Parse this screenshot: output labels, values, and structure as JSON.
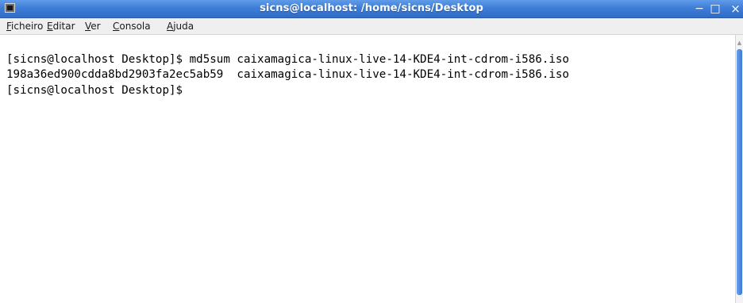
{
  "window": {
    "title": "sicns@localhost: /home/sicns/Desktop",
    "minimize_glyph": "−",
    "maximize_glyph": "□",
    "close_glyph": "×",
    "titlebar_color": "#3f7ed8"
  },
  "menubar": {
    "items": [
      {
        "accel": "F",
        "rest": "icheiro"
      },
      {
        "accel": "E",
        "rest": "ditar"
      },
      {
        "accel": "V",
        "rest": "er"
      },
      {
        "accel": "C",
        "rest": "onsola"
      },
      {
        "accel": "A",
        "rest": "juda"
      }
    ]
  },
  "terminal": {
    "lines": [
      "[sicns@localhost Desktop]$ md5sum caixamagica-linux-live-14-KDE4-int-cdrom-i586.iso",
      "198a36ed900cdda8bd2903fa2ec5ab59  caixamagica-linux-live-14-KDE4-int-cdrom-i586.iso",
      "[sicns@localhost Desktop]$"
    ]
  },
  "scrollbar": {
    "up_arrow_glyph": "▲"
  }
}
